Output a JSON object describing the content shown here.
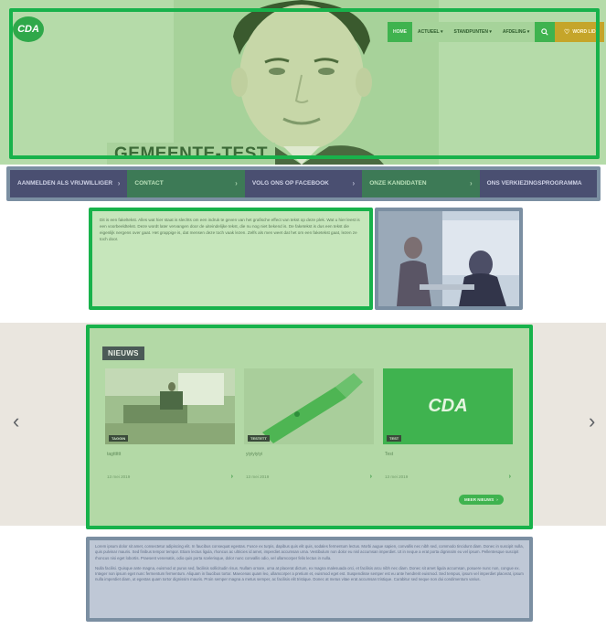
{
  "hero": {
    "logo_text": "CDA",
    "title": "GEMEENTE-TEST",
    "nav": [
      {
        "label": "HOME",
        "active": true
      },
      {
        "label": "ACTUEEL",
        "dropdown": true
      },
      {
        "label": "STANDPUNTEN",
        "dropdown": true
      },
      {
        "label": "AFDELING",
        "dropdown": true
      }
    ],
    "search_icon": "search-icon",
    "member_label": "WORD LID",
    "member_icon": "heart-icon"
  },
  "quick_links": [
    {
      "label": "AANMELDEN ALS VRIJWILLIGER"
    },
    {
      "label": "CONTACT"
    },
    {
      "label": "VOLG ONS OP FACEBOOK"
    },
    {
      "label": "ONZE KANDIDATEN"
    },
    {
      "label": "ONS VERKIEZINGSPROGRAMMA"
    }
  ],
  "intro": {
    "text": "Dit is een fakeltekst. Alles wat hier staat is slechts om een indruk te geven van het grafische effect van tekst op deze plek. Wat u hier leest is een voorbeeldtekst. Deze wordt later vervangen door de uiteindelijke tekst, die nu nog niet bekend is. De faketekst is dus een tekst die eigenlijk nergens over gaat. Het grappige is, dat mensen deze toch vaak lezen. Zelfs als men weet dat het om een faketekst gaat, lezen ze toch door."
  },
  "news": {
    "heading": "NIEUWS",
    "more_label": "MEER NIEUWS",
    "items": [
      {
        "tag": "TAGGIN",
        "title": "tagtttttt",
        "date": "13 mei 2019"
      },
      {
        "tag": "TESTETT",
        "title": "yiyiyiyiyi",
        "date": "13 mei 2019"
      },
      {
        "tag": "TEST",
        "title": "Test",
        "date": "13 mei 2019",
        "logo": "CDA"
      }
    ]
  },
  "body_text": {
    "p1": "Lorem ipsum dolor sit amet, consectetur adipiscing elit. In faucibus consequat egestas. Fusce ex turpis, dapibus quis elit quis, sodales fermentum lectus. Morbi augue sapien, convallis nec nibh sed, commodo tincidunt diam. Donec in suscipit nulla, quis pulvinar mauris. Sed finibus tempor tempor. Etiam lectus ligula, rhoncus ac ultricies id amet, imperdiet accumsan urna. Vestibulum non dolor eu nisl accumsan imperdiet. Ut in neque a erat porta dignissim eu vel ipsum. Pellentesque suscipit rhoncus nisi eget lobortis. Praesent venenatis, odio quis porta scelerisque, dolor nunc convallis odio, vel ullamcorper felis lectus in nulla.",
    "p2": "Nulla facilisi. Quisque ante magna, euismod ut purus sed, facilisis sollicitudin risus. Nullam ornare, urna at placerat dictum, ex magna malesuada orci, et facilisis arcu nibh nec diam. Donec sit amet ligula accumsan, posuere nunc non, congue ex. Integer non ipsum eget nunc fermentum fermentum. Aliquam in faucibus tortor. Maecenas quam leo, ullamcorper a pretium et, euismod eget est. Suspendisse semper est eu ante hendrerit euismod. Sed tempus, ipsum vel imperdiet placerat, ipsum nulla imperdiet diam, ut egestas quam tortor dignissim mauris. Proin semper magna a metus semper, ac facilisis elit tristique. Donec at metus vitae erat accumsan tristique. Curabitur sed neque non dui condimentum varius."
  },
  "carousel": {
    "prev_icon": "chevron-left-icon",
    "next_icon": "chevron-right-icon"
  }
}
